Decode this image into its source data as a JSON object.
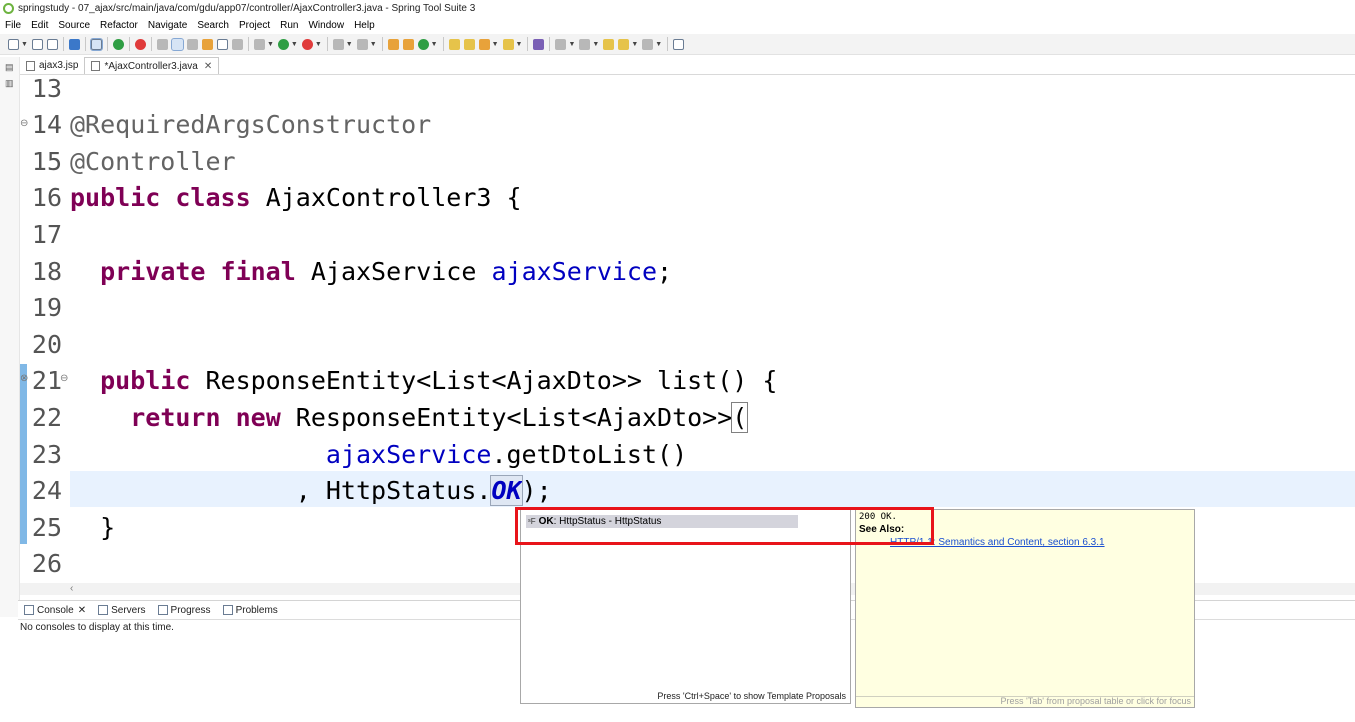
{
  "window": {
    "title": "springstudy - 07_ajax/src/main/java/com/gdu/app07/controller/AjaxController3.java - Spring Tool Suite 3"
  },
  "menu": [
    "File",
    "Edit",
    "Source",
    "Refactor",
    "Navigate",
    "Search",
    "Project",
    "Run",
    "Window",
    "Help"
  ],
  "tabs": [
    {
      "label": "ajax3.jsp",
      "active": false
    },
    {
      "label": "*AjaxController3.java",
      "active": true
    }
  ],
  "editor": {
    "lines": [
      {
        "num": "13",
        "tokens": []
      },
      {
        "num": "14",
        "tokens": [
          {
            "t": "@RequiredArgsConstructor",
            "c": "ann"
          }
        ]
      },
      {
        "num": "15",
        "tokens": [
          {
            "t": "@Controller",
            "c": "ann"
          }
        ]
      },
      {
        "num": "16",
        "tokens": [
          {
            "t": "public",
            "c": "kw"
          },
          {
            "t": " ",
            "c": "plain"
          },
          {
            "t": "class",
            "c": "kw"
          },
          {
            "t": " AjaxController3 {",
            "c": "plain"
          }
        ]
      },
      {
        "num": "17",
        "tokens": []
      },
      {
        "num": "18",
        "tokens": [
          {
            "t": "  ",
            "c": "plain"
          },
          {
            "t": "private",
            "c": "kw"
          },
          {
            "t": " ",
            "c": "plain"
          },
          {
            "t": "final",
            "c": "kw"
          },
          {
            "t": " AjaxService ",
            "c": "plain"
          },
          {
            "t": "ajaxService",
            "c": "fld"
          },
          {
            "t": ";",
            "c": "plain"
          }
        ]
      },
      {
        "num": "19",
        "tokens": []
      },
      {
        "num": "20",
        "tokens": []
      },
      {
        "num": "21",
        "tokens": [
          {
            "t": "  ",
            "c": "plain"
          },
          {
            "t": "public",
            "c": "kw"
          },
          {
            "t": " ResponseEntity<List<AjaxDto>> list() {",
            "c": "plain"
          }
        ]
      },
      {
        "num": "22",
        "tokens": [
          {
            "t": "    ",
            "c": "plain"
          },
          {
            "t": "return",
            "c": "kw"
          },
          {
            "t": " ",
            "c": "plain"
          },
          {
            "t": "new",
            "c": "kw"
          },
          {
            "t": " ResponseEntity<List<AjaxDto>>",
            "c": "plain"
          },
          {
            "t": "(",
            "c": "bracket"
          }
        ]
      },
      {
        "num": "23",
        "tokens": [
          {
            "t": "                 ",
            "c": "plain"
          },
          {
            "t": "ajaxService",
            "c": "fld"
          },
          {
            "t": ".getDtoList()",
            "c": "plain"
          }
        ]
      },
      {
        "num": "24",
        "tokens": [
          {
            "t": "               , HttpStatus.",
            "c": "plain"
          },
          {
            "t": "OK",
            "c": "const"
          },
          {
            "t": ");",
            "c": "plain"
          }
        ]
      },
      {
        "num": "25",
        "tokens": [
          {
            "t": "  }",
            "c": "plain"
          }
        ]
      },
      {
        "num": "26",
        "tokens": []
      }
    ]
  },
  "bottom_panel": {
    "tabs": [
      "Console",
      "Servers",
      "Progress",
      "Problems"
    ],
    "message": "No consoles to display at this time."
  },
  "proposal": {
    "item_bold": "OK",
    "item_rest": " : HttpStatus - HttpStatus",
    "footer": "Press 'Ctrl+Space' to show Template Proposals"
  },
  "doc": {
    "code": "200 OK.",
    "see_also": "See Also:",
    "link": "HTTP/1.1: Semantics and Content, section 6.3.1",
    "footer": "Press 'Tab' from proposal table or click for focus"
  },
  "colors": {
    "highlight_box": "#e8141a",
    "keyword": "#7f0055",
    "field": "#0000c0",
    "annotation": "#646464"
  }
}
